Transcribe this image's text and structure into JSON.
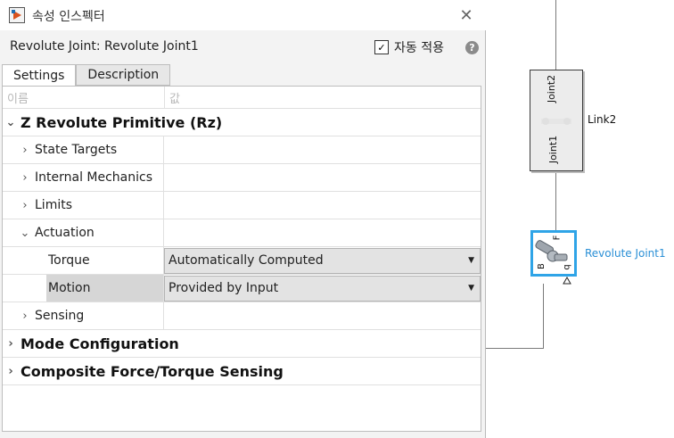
{
  "window": {
    "title": "속성 인스펙터",
    "close_glyph": "✕"
  },
  "header": {
    "block_title": "Revolute Joint: Revolute Joint1",
    "auto_apply_label": "자동 적용",
    "auto_apply_checked": true,
    "checkbox_glyph": "✓",
    "help_glyph": "?"
  },
  "tabs": [
    {
      "label": "Settings",
      "active": true
    },
    {
      "label": "Description",
      "active": false
    }
  ],
  "grid": {
    "col_name": "이름",
    "col_value": "값",
    "rows": [
      {
        "label": "Z Revolute Primitive (Rz)",
        "kind": "group",
        "expanded": true
      },
      {
        "label": "State Targets",
        "kind": "sub",
        "expanded": false
      },
      {
        "label": "Internal Mechanics",
        "kind": "sub",
        "expanded": false
      },
      {
        "label": "Limits",
        "kind": "sub",
        "expanded": false
      },
      {
        "label": "Actuation",
        "kind": "sub",
        "expanded": true
      },
      {
        "label": "Torque",
        "kind": "param",
        "value": "Automatically Computed"
      },
      {
        "label": "Motion",
        "kind": "param",
        "value": "Provided by Input",
        "selected": true
      },
      {
        "label": "Sensing",
        "kind": "sub",
        "expanded": false
      },
      {
        "label": "Mode Configuration",
        "kind": "group",
        "expanded": false
      },
      {
        "label": "Composite Force/Torque Sensing",
        "kind": "group",
        "expanded": false
      }
    ]
  },
  "canvas": {
    "link2_block": {
      "label": "Link2",
      "port_top": "Joint2",
      "port_bottom": "Joint1"
    },
    "joint_block": {
      "label": "Revolute Joint1",
      "port_b": "B",
      "port_f": "F",
      "port_q": "q"
    }
  },
  "colors": {
    "selection": "#2fa4e7",
    "joint_label": "#2a8fd6"
  },
  "icons": {
    "app": "simulink-app-icon",
    "close": "close-icon",
    "help": "help-icon",
    "expand": "chevron-right-icon",
    "collapse": "chevron-down-icon",
    "dropdown": "dropdown-arrow-icon",
    "joint": "revolute-joint-icon"
  }
}
